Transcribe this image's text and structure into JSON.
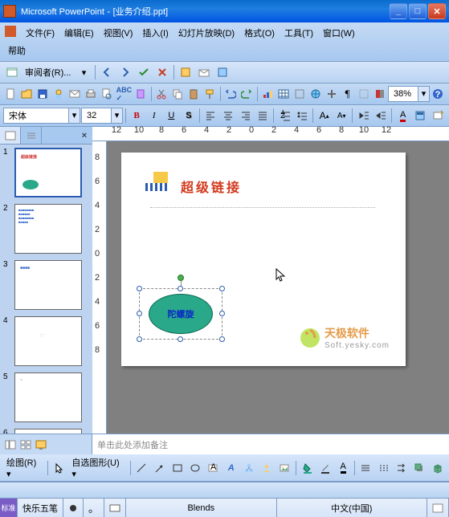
{
  "titlebar": {
    "app": "Microsoft PowerPoint",
    "doc": "[业务介绍.ppt]",
    "min": "_",
    "max": "□",
    "close": "✕"
  },
  "menu": {
    "file": "文件(F)",
    "edit": "编辑(E)",
    "view": "视图(V)",
    "insert": "插入(I)",
    "slideshow": "幻灯片放映(D)",
    "format": "格式(O)",
    "tools": "工具(T)",
    "window": "窗口(W)",
    "help": "帮助"
  },
  "review_bar": {
    "reviewer_label": "审阅者(R)..."
  },
  "format_bar": {
    "font": "宋体",
    "size": "32",
    "zoom": "38%"
  },
  "ruler": {
    "h_nums": [
      "12",
      "10",
      "8",
      "6",
      "4",
      "2",
      "0",
      "2",
      "4",
      "6",
      "8",
      "10",
      "12"
    ],
    "v_nums": [
      "8",
      "6",
      "4",
      "2",
      "0",
      "2",
      "4",
      "6",
      "8"
    ]
  },
  "thumbs": {
    "count": 6,
    "nums": [
      "1",
      "2",
      "3",
      "4",
      "5",
      "6"
    ],
    "close": "×"
  },
  "slide": {
    "title_text": "超级链接",
    "oval_text": "陀螺旋",
    "watermark_txt": "天极软件",
    "watermark_sub": "Soft.yesky.com"
  },
  "notes": {
    "placeholder": "单击此处添加备注"
  },
  "draw_bar": {
    "draw_label": "绘图(R)",
    "autoshape": "自选图形(U)"
  },
  "ime": {
    "name": "快乐五笔",
    "cand": "Blends",
    "lang": "中文(中国)"
  }
}
